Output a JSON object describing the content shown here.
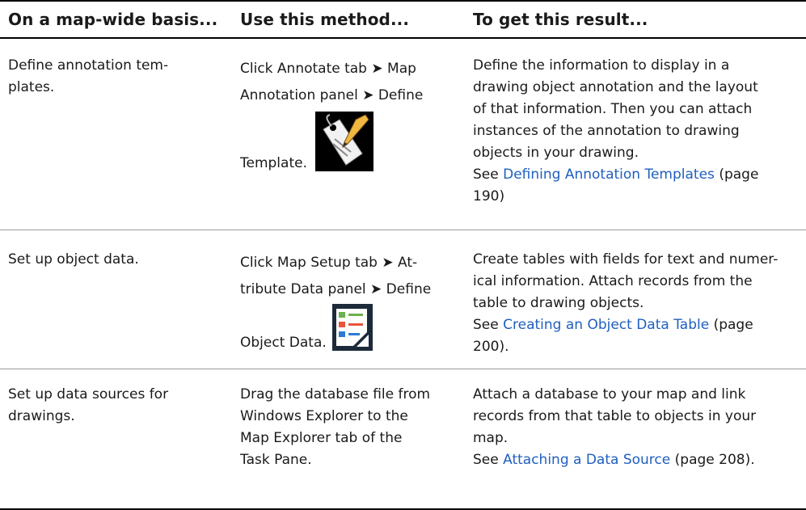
{
  "headers": {
    "col1": "On a map-wide basis...",
    "col2": "Use this method...",
    "col3": "To get this result..."
  },
  "rows": [
    {
      "col1": "Define annotation tem-\nplates.",
      "col2_line1": "Click Annotate tab ➤ Map",
      "col2_line2": "Annotation panel ➤ Define",
      "col2_line3": "Template.",
      "col2_icon": "annotation-template-icon",
      "col3_lines": [
        "Define the information to display in a",
        "drawing object annotation and the layout",
        "of that information. Then you can attach",
        "instances of the annotation to drawing",
        "objects in your drawing."
      ],
      "see_prefix": "See",
      "see_link": "Defining Annotation Templates",
      "see_page_a": "(page",
      "see_page_b": "190)"
    },
    {
      "col1": "Set up object data.",
      "col2_line1": "Click Map Setup tab ➤ At-",
      "col2_line2": "tribute Data panel ➤ Define",
      "col2_line3": "Object Data.",
      "col2_icon": "object-data-icon",
      "col3_lines": [
        "Create tables with fields for text and numer-",
        "ical information. Attach records from the",
        "table to drawing objects."
      ],
      "see_prefix": "See",
      "see_link": "Creating an Object Data Table",
      "see_page_a": "(page",
      "see_page_b": "200)."
    },
    {
      "col1": "Set up data sources for\ndrawings.",
      "col2_lines": [
        "Drag the database file from",
        "Windows Explorer to the",
        "Map Explorer tab of the",
        "Task Pane."
      ],
      "col3_lines": [
        "Attach a database to your map and link",
        "records from that table to objects in your",
        "map."
      ],
      "see_prefix": "See",
      "see_link": "Attaching a Data Source",
      "see_page": "(page 208)."
    }
  ]
}
